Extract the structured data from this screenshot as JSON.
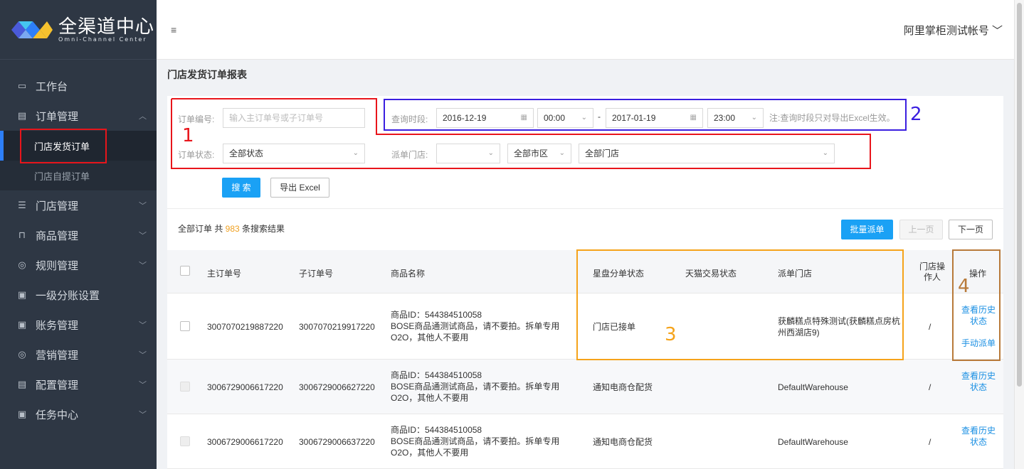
{
  "brand": {
    "name_cn": "全渠道中心",
    "name_en": "Omni-Channel Center",
    "colors": [
      "#2d7ff9",
      "#45c6f0",
      "#f5c12e",
      "#4a5ad9"
    ]
  },
  "header": {
    "menu_icon": "≡",
    "account": "阿里掌柜测试帐号 ﹀"
  },
  "sidebar": {
    "items": [
      {
        "label": "工作台",
        "icon": "monitor-icon",
        "glyph": "▭"
      },
      {
        "label": "订单管理",
        "icon": "order-icon",
        "glyph": "▤",
        "chevron": "︿"
      },
      {
        "label": "门店管理",
        "icon": "store-list-icon",
        "glyph": "☰",
        "chevron": "﹀"
      },
      {
        "label": "商品管理",
        "icon": "bag-icon",
        "glyph": "⊓",
        "chevron": "﹀"
      },
      {
        "label": "规则管理",
        "icon": "rule-icon",
        "glyph": "◎",
        "chevron": "﹀"
      },
      {
        "label": "一级分账设置",
        "icon": "split-icon",
        "glyph": "▣"
      },
      {
        "label": "账务管理",
        "icon": "account-book-icon",
        "glyph": "▣",
        "chevron": "﹀"
      },
      {
        "label": "营销管理",
        "icon": "marketing-icon",
        "glyph": "◎",
        "chevron": "﹀"
      },
      {
        "label": "配置管理",
        "icon": "config-icon",
        "glyph": "▤",
        "chevron": "﹀"
      },
      {
        "label": "任务中心",
        "icon": "task-icon",
        "glyph": "▣",
        "chevron": "﹀"
      }
    ],
    "sub_items": [
      {
        "label": "门店发货订单"
      },
      {
        "label": "门店自提订单"
      }
    ]
  },
  "page": {
    "title": "门店发货订单报表"
  },
  "filters": {
    "order_no_label": "订单编号:",
    "order_no_placeholder": "输入主订单号或子订单号",
    "period_label": "查询时段:",
    "date_from": "2016-12-19",
    "time_from": "00:00",
    "dash": "-",
    "date_to": "2017-01-19",
    "time_to": "23:00",
    "period_note": "注:查询时段只对导出Excel生效。",
    "status_label": "订单状态:",
    "status_value": "全部状态",
    "store_label": "派单门店:",
    "store_city": "全部市区",
    "store_all": "全部门店",
    "select_arrow": "⌄",
    "calendar_glyph": "▦"
  },
  "actions": {
    "search": "搜 索",
    "export": "导出 Excel",
    "batch_dispatch": "批量派单",
    "prev": "上一页",
    "next": "下一页"
  },
  "result": {
    "prefix": "全部订单 共 ",
    "count": "983",
    "suffix": " 条搜索结果"
  },
  "table": {
    "headers": {
      "main_order": "主订单号",
      "sub_order": "子订单号",
      "product": "商品名称",
      "star_status": "星盘分单状态",
      "tmall_status": "天猫交易状态",
      "store": "派单门店",
      "operator": "门店操作人",
      "operation": "操作"
    },
    "rows": [
      {
        "main": "3007070219887220",
        "sub": "3007070219917220",
        "product_id": "商品ID：544384510058",
        "product_line1": "BOSE商品通测试商品，请不要拍。拆单专用",
        "product_line2": "O2O，其他人不要用",
        "star": "门店已接单",
        "tmall": "",
        "store": "获麟糕点特殊测试(获麟糕点房杭州西湖店9)",
        "operator": "/",
        "op1": "查看历史状态",
        "op2": "手动派单"
      },
      {
        "main": "3006729006617220",
        "sub": "3006729006627220",
        "product_id": "商品ID：544384510058",
        "product_line1": "BOSE商品通测试商品，请不要拍。拆单专用",
        "product_line2": "O2O，其他人不要用",
        "star": "通知电商仓配货",
        "tmall": "",
        "store": "DefaultWarehouse",
        "operator": "/",
        "op1": "查看历史状态",
        "op2": ""
      },
      {
        "main": "3006729006617220",
        "sub": "3006729006637220",
        "product_id": "商品ID：544384510058",
        "product_line1": "BOSE商品通测试商品，请不要拍。拆单专用",
        "product_line2": "O2O，其他人不要用",
        "star": "通知电商仓配货",
        "tmall": "",
        "store": "DefaultWarehouse",
        "operator": "/",
        "op1": "查看历史状态",
        "op2": ""
      }
    ]
  },
  "annotations": {
    "n1": "1",
    "n2": "2",
    "n3": "3",
    "n4": "4",
    "colors": {
      "red": "#e8151b",
      "blue": "#3b1fe0",
      "orange": "#f5a31a",
      "brown": "#b87a3a"
    }
  }
}
